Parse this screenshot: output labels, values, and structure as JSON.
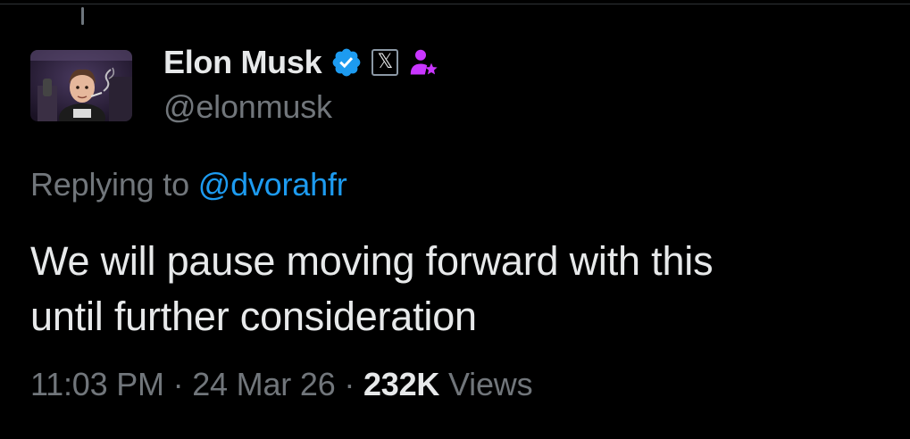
{
  "author": {
    "display_name": "Elon Musk",
    "handle": "@elonmusk",
    "affiliate_glyph": "𝕏"
  },
  "reply": {
    "prefix": "Replying to ",
    "mention": "@dvorahfr"
  },
  "tweet": {
    "text_line1": "We will pause moving forward with this",
    "text_line2": "until further consideration"
  },
  "meta": {
    "time": "11:03 PM",
    "sep1": " · ",
    "date": "24 Mar 26",
    "sep2": " · ",
    "views_count": "232K",
    "views_label": " Views"
  },
  "colors": {
    "background": "#000000",
    "primary_text": "#e7e9ea",
    "secondary_text": "#71767b",
    "link": "#1d9bf0",
    "verified": "#1d9bf0",
    "role_icon": "#c936ff"
  },
  "icons": {
    "verified": "verified-badge-icon",
    "affiliate": "x-affiliate-badge-icon",
    "role": "star-person-icon"
  }
}
